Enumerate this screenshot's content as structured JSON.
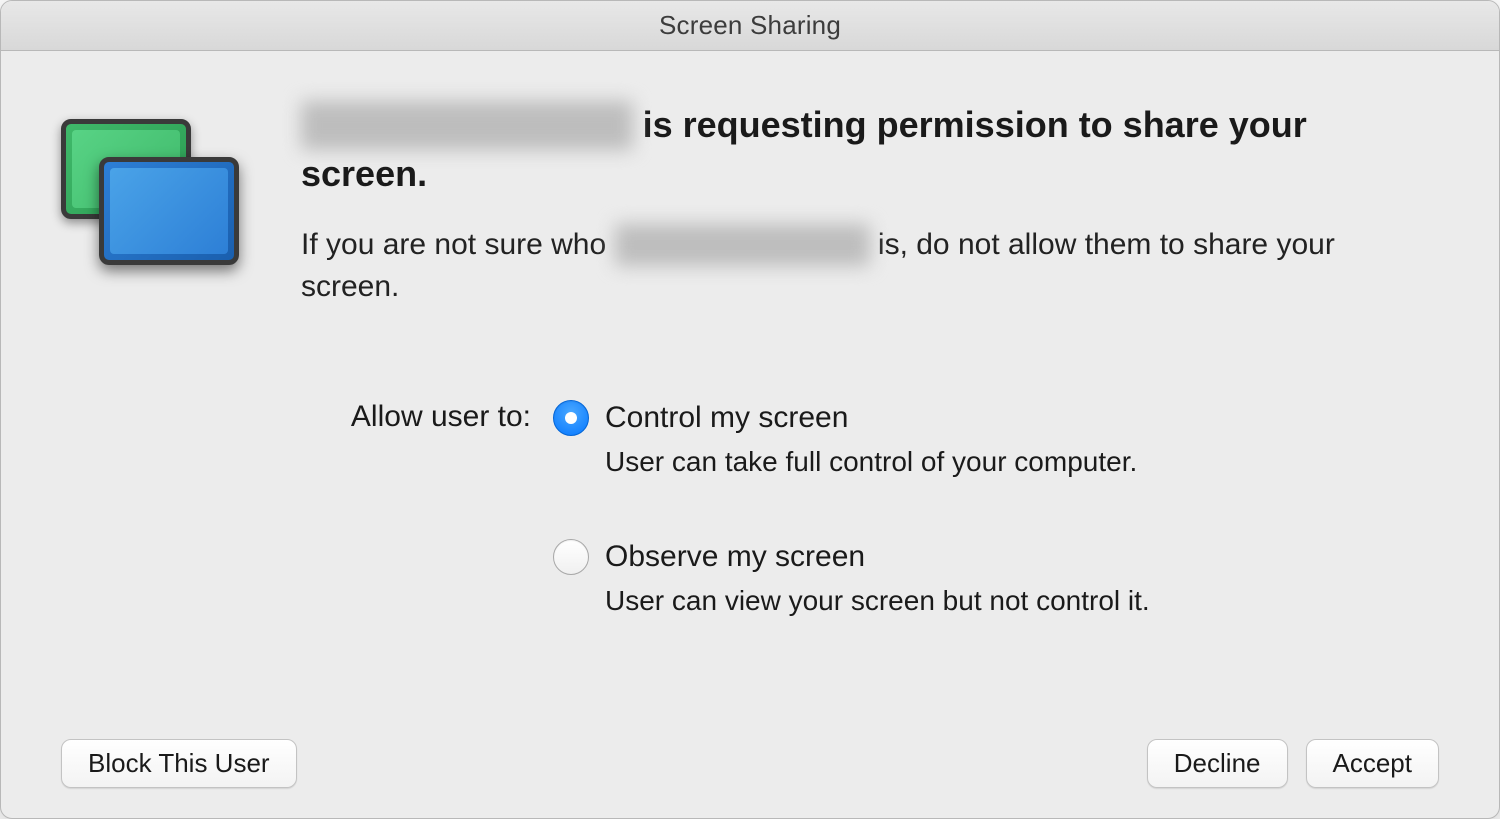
{
  "window": {
    "title": "Screen Sharing"
  },
  "headline": {
    "prefix_redacted": "█████████████",
    "text": " is requesting permission to share your screen."
  },
  "subtext": {
    "prefix": "If you are not sure who ",
    "middle_redacted": "████████████",
    "suffix": " is, do not allow them to share your screen."
  },
  "allow_label": "Allow user to:",
  "options": [
    {
      "title": "Control my screen",
      "desc": "User can take full control of your computer.",
      "checked": true
    },
    {
      "title": "Observe my screen",
      "desc": "User can view your screen but not control it.",
      "checked": false
    }
  ],
  "buttons": {
    "block": "Block This User",
    "decline": "Decline",
    "accept": "Accept"
  }
}
